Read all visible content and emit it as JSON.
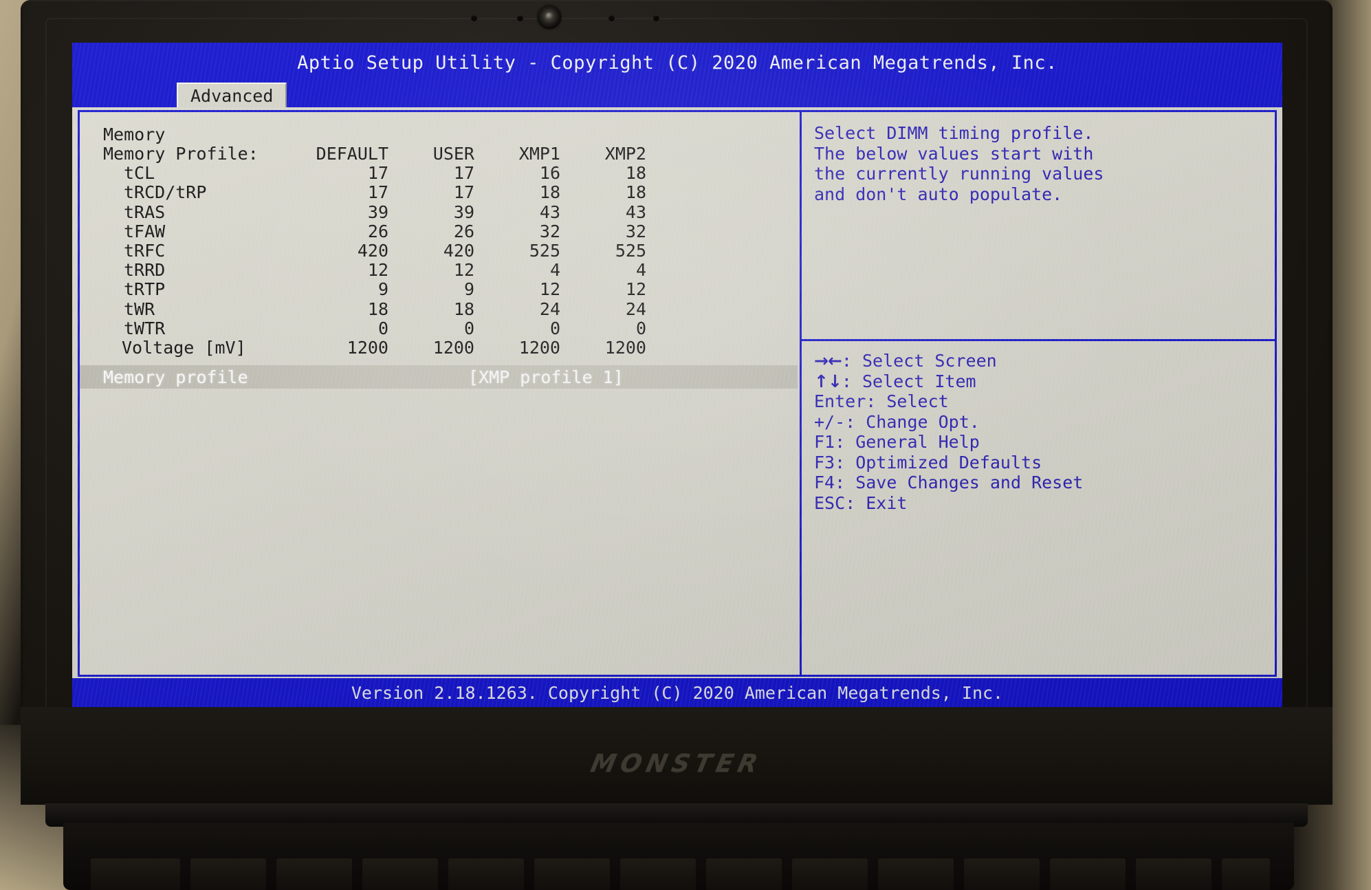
{
  "window": {
    "title": "Aptio Setup Utility - Copyright (C) 2020 American Megatrends, Inc.",
    "footer": "Version 2.18.1263. Copyright (C) 2020 American Megatrends, Inc.",
    "brand": "MONSTER"
  },
  "tabs": [
    {
      "label": "Advanced",
      "active": true
    }
  ],
  "main": {
    "section_title": "Memory",
    "table": {
      "header_label": "Memory Profile:",
      "columns": [
        "DEFAULT",
        "USER",
        "XMP1",
        "XMP2"
      ],
      "rows": [
        {
          "label": "tCL",
          "values": [
            "17",
            "17",
            "16",
            "18"
          ]
        },
        {
          "label": "tRCD/tRP",
          "values": [
            "17",
            "17",
            "18",
            "18"
          ]
        },
        {
          "label": "tRAS",
          "values": [
            "39",
            "39",
            "43",
            "43"
          ]
        },
        {
          "label": "tFAW",
          "values": [
            "26",
            "26",
            "32",
            "32"
          ]
        },
        {
          "label": "tRFC",
          "values": [
            "420",
            "420",
            "525",
            "525"
          ]
        },
        {
          "label": "tRRD",
          "values": [
            "12",
            "12",
            "4",
            "4"
          ]
        },
        {
          "label": "tRTP",
          "values": [
            "9",
            "9",
            "12",
            "12"
          ]
        },
        {
          "label": "tWR",
          "values": [
            "18",
            "18",
            "24",
            "24"
          ]
        },
        {
          "label": "tWTR",
          "values": [
            "0",
            "0",
            "0",
            "0"
          ]
        },
        {
          "label": "Voltage [mV]",
          "values": [
            "1200",
            "1200",
            "1200",
            "1200"
          ]
        }
      ]
    },
    "selected_item": {
      "label": "Memory profile",
      "value": "[XMP profile 1]"
    }
  },
  "help": {
    "lines": [
      "Select DIMM timing profile.",
      "The below values start with",
      "the currently running values",
      "and don't auto populate."
    ]
  },
  "keys": [
    {
      "glyph": "→←",
      "text": ": Select Screen"
    },
    {
      "glyph": "↑↓",
      "text": ": Select Item"
    },
    {
      "glyph": "",
      "text": "Enter: Select"
    },
    {
      "glyph": "",
      "text": "+/-: Change Opt."
    },
    {
      "glyph": "",
      "text": "F1: General Help"
    },
    {
      "glyph": "",
      "text": "F3: Optimized Defaults"
    },
    {
      "glyph": "",
      "text": "F4: Save Changes and Reset"
    },
    {
      "glyph": "",
      "text": "ESC: Exit"
    }
  ],
  "colors": {
    "bios_blue": "#1414cf",
    "panel_bg": "#dcdbd1",
    "text_blue": "#2b20b8",
    "text_dark": "#141414",
    "highlight_text": "#ffffff"
  }
}
